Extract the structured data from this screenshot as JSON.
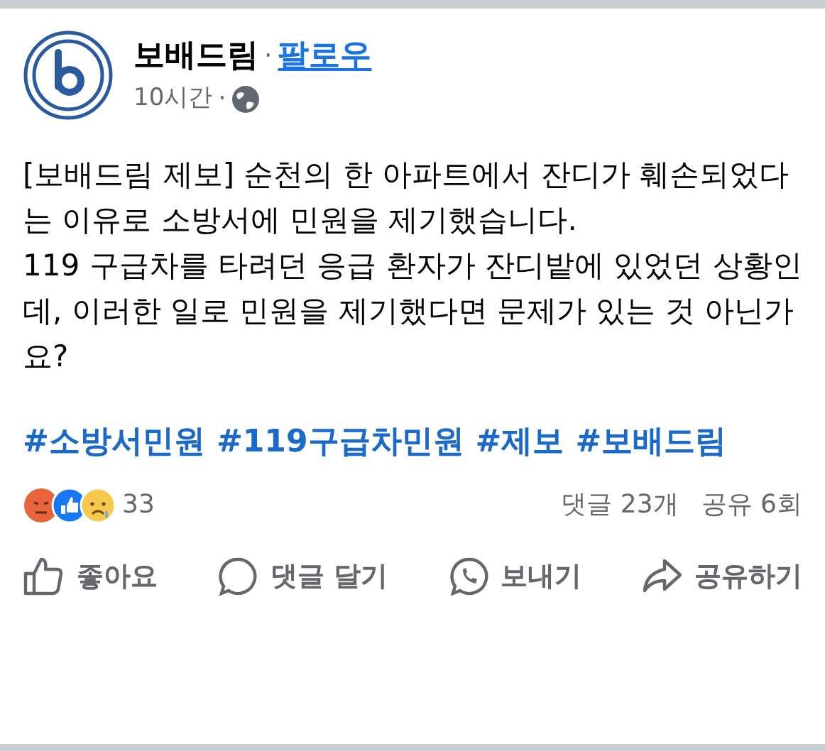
{
  "post": {
    "author": "보배드림",
    "separator": "·",
    "follow": "팔로우",
    "time": "10시간",
    "time_separator": "·",
    "body": [
      "[보배드림 제보] 순천의 한 아파트에서 잔디가 훼손되었다는 이유로 소방서에 민원을 제기했습니다.",
      "119 구급차를 타려던 응급 환자가 잔디밭에 있었던 상황인데, 이러한 일로 민원을 제기했다면 문제가 있는 것 아닌가요?"
    ],
    "hashtags": [
      "#소방서민원",
      "#119구급차민원",
      "#제보",
      "#보배드림"
    ],
    "reactions": {
      "count": "33",
      "comments": "댓글 23개",
      "shares": "공유 6회"
    },
    "actions": [
      {
        "kind": "like",
        "label": "좋아요"
      },
      {
        "kind": "comment",
        "label": "댓글 달기"
      },
      {
        "kind": "send",
        "label": "보내기"
      },
      {
        "kind": "share",
        "label": "공유하기"
      }
    ]
  }
}
